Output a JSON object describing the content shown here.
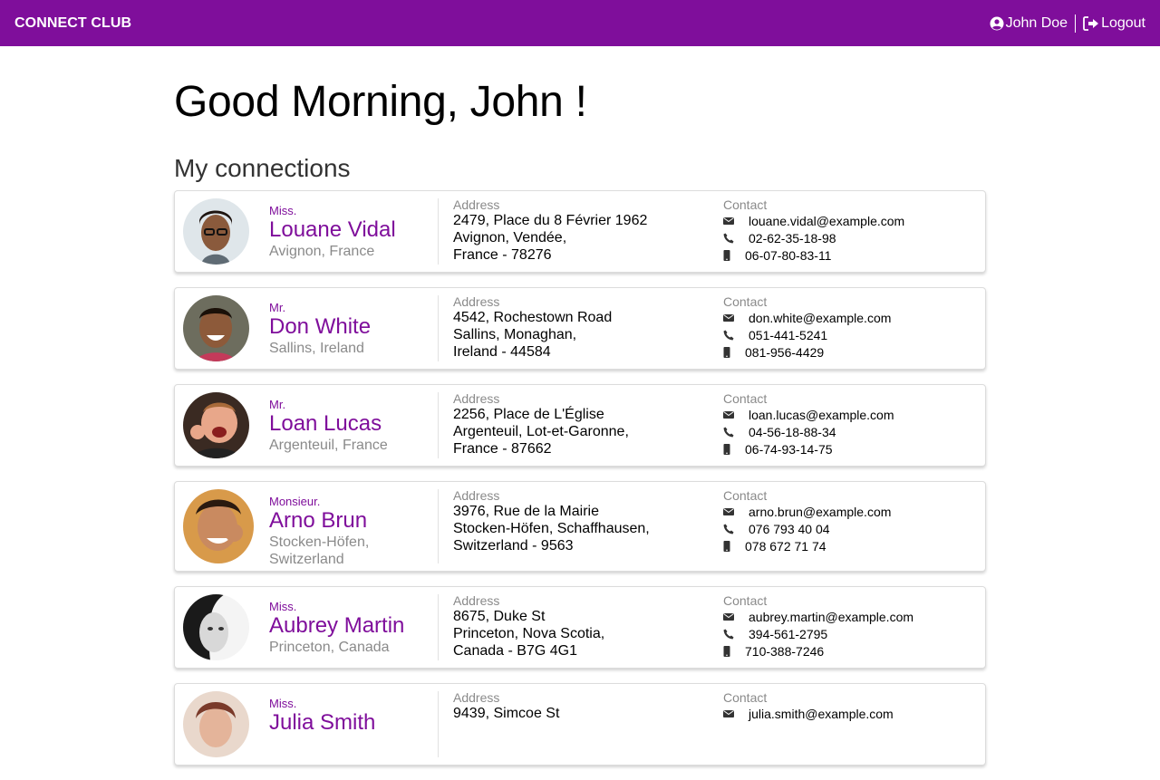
{
  "nav": {
    "brand": "CONNECT CLUB",
    "user_label": "John Doe",
    "logout_label": "Logout",
    "color": "#7f0e9b"
  },
  "greeting": "Good Morning, John !",
  "section_title": "My connections",
  "labels": {
    "address": "Address",
    "contact": "Contact"
  },
  "connections": [
    {
      "title": "Miss.",
      "name": "Louane Vidal",
      "place": "Avignon, France",
      "address": [
        "2479, Place du 8 Février 1962",
        "Avignon, Vendée,",
        "France - 78276"
      ],
      "email": "louane.vidal@example.com",
      "phone": "02-62-35-18-98",
      "mobile": "06-07-80-83-11"
    },
    {
      "title": "Mr.",
      "name": "Don White",
      "place": "Sallins, Ireland",
      "address": [
        "4542, Rochestown Road",
        "Sallins, Monaghan,",
        "Ireland - 44584"
      ],
      "email": "don.white@example.com",
      "phone": "051-441-5241",
      "mobile": "081-956-4429"
    },
    {
      "title": "Mr.",
      "name": "Loan Lucas",
      "place": "Argenteuil, France",
      "address": [
        "2256, Place de L'Église",
        "Argenteuil, Lot-et-Garonne,",
        "France - 87662"
      ],
      "email": "loan.lucas@example.com",
      "phone": "04-56-18-88-34",
      "mobile": "06-74-93-14-75"
    },
    {
      "title": "Monsieur.",
      "name": "Arno Brun",
      "place": "Stocken-Höfen, Switzerland",
      "address": [
        "3976, Rue de la Mairie",
        "Stocken-Höfen, Schaffhausen,",
        "Switzerland - 9563"
      ],
      "email": "arno.brun@example.com",
      "phone": "076 793 40 04",
      "mobile": "078 672 71 74"
    },
    {
      "title": "Miss.",
      "name": "Aubrey Martin",
      "place": "Princeton, Canada",
      "address": [
        "8675, Duke St",
        "Princeton, Nova Scotia,",
        "Canada - B7G 4G1"
      ],
      "email": "aubrey.martin@example.com",
      "phone": "394-561-2795",
      "mobile": "710-388-7246"
    },
    {
      "title": "Miss.",
      "name": "Julia Smith",
      "place": "",
      "address": [
        "9439, Simcoe St",
        "",
        ""
      ],
      "email": "julia.smith@example.com",
      "phone": "",
      "mobile": ""
    }
  ]
}
